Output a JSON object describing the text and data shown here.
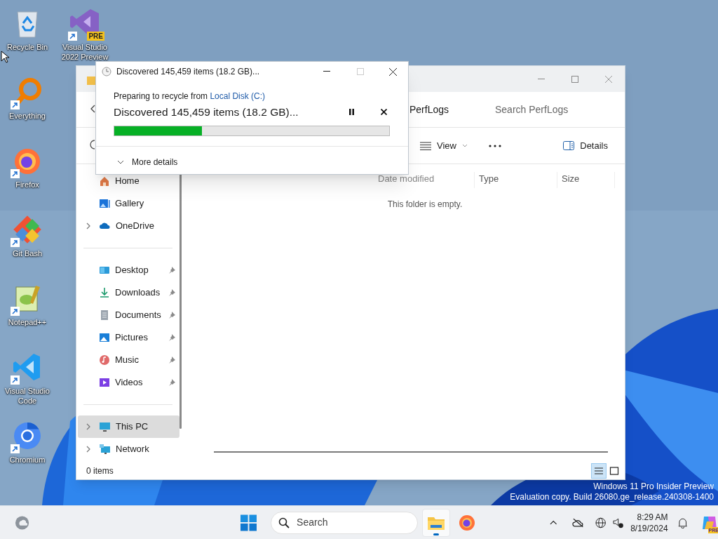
{
  "desktop_icons": [
    {
      "label": "Recycle Bin",
      "kind": "recycle",
      "shortcut": false
    },
    {
      "label": "Visual Studio 2022 Preview",
      "kind": "visualstudio",
      "shortcut": true,
      "badge": "PRE"
    },
    {
      "label": "Everything",
      "kind": "everything",
      "shortcut": true
    },
    {
      "label": "Firefox",
      "kind": "firefox",
      "shortcut": true
    },
    {
      "label": "Git Bash",
      "kind": "git",
      "shortcut": true
    },
    {
      "label": "Notepad++",
      "kind": "notepad",
      "shortcut": true
    },
    {
      "label": "Visual Studio Code",
      "kind": "vscode",
      "shortcut": true
    },
    {
      "label": "Chromium",
      "kind": "chromium",
      "shortcut": true
    }
  ],
  "explorer": {
    "breadcrumb": "PerfLogs",
    "search": {
      "placeholder": "Search PerfLogs"
    },
    "toolbar": {
      "view": "View",
      "details": "Details"
    },
    "sidebar": {
      "groups": [
        [
          {
            "label": "Home",
            "kind": "home",
            "expandable": false,
            "pinned": false,
            "selected": false
          },
          {
            "label": "Gallery",
            "kind": "gallery",
            "expandable": false,
            "pinned": false,
            "selected": false
          },
          {
            "label": "OneDrive",
            "kind": "cloud",
            "expandable": true,
            "pinned": false,
            "selected": false
          }
        ],
        [
          {
            "label": "Desktop",
            "kind": "desktop",
            "expandable": false,
            "pinned": true,
            "selected": false
          },
          {
            "label": "Downloads",
            "kind": "downloads",
            "expandable": false,
            "pinned": true,
            "selected": false
          },
          {
            "label": "Documents",
            "kind": "documents",
            "expandable": false,
            "pinned": true,
            "selected": false
          },
          {
            "label": "Pictures",
            "kind": "pictures",
            "expandable": false,
            "pinned": true,
            "selected": false
          },
          {
            "label": "Music",
            "kind": "music",
            "expandable": false,
            "pinned": true,
            "selected": false
          },
          {
            "label": "Videos",
            "kind": "videos",
            "expandable": false,
            "pinned": true,
            "selected": false
          }
        ],
        [
          {
            "label": "This PC",
            "kind": "pc",
            "expandable": true,
            "pinned": false,
            "selected": true
          },
          {
            "label": "Network",
            "kind": "network",
            "expandable": true,
            "pinned": false,
            "selected": false
          }
        ]
      ]
    },
    "columns": [
      "Date modified",
      "Type",
      "Size"
    ],
    "empty_message": "This folder is empty.",
    "status": "0 items",
    "view_buttons": [
      {
        "kind": "details",
        "selected": true
      },
      {
        "kind": "tiles",
        "selected": false
      }
    ]
  },
  "dialog": {
    "title": "Discovered 145,459 items (18.2 GB)...",
    "prefix": "Preparing to recycle from",
    "source_link": "Local Disk (C:)",
    "heading": "Discovered 145,459 items (18.2 GB)...",
    "level": 0.32,
    "more_details": "More details"
  },
  "watermark": [
    "Windows 11 Pro Insider Preview",
    "Evaluation copy. Build 26080.ge_release.240308-1400"
  ],
  "taskbar": {
    "search_placeholder": "Search",
    "apps": [
      {
        "kind": "explorer",
        "active": true
      },
      {
        "kind": "firefox",
        "active": false
      }
    ],
    "time": "8:29 AM",
    "date": "8/19/2024",
    "copilot_badge": "PRE"
  }
}
